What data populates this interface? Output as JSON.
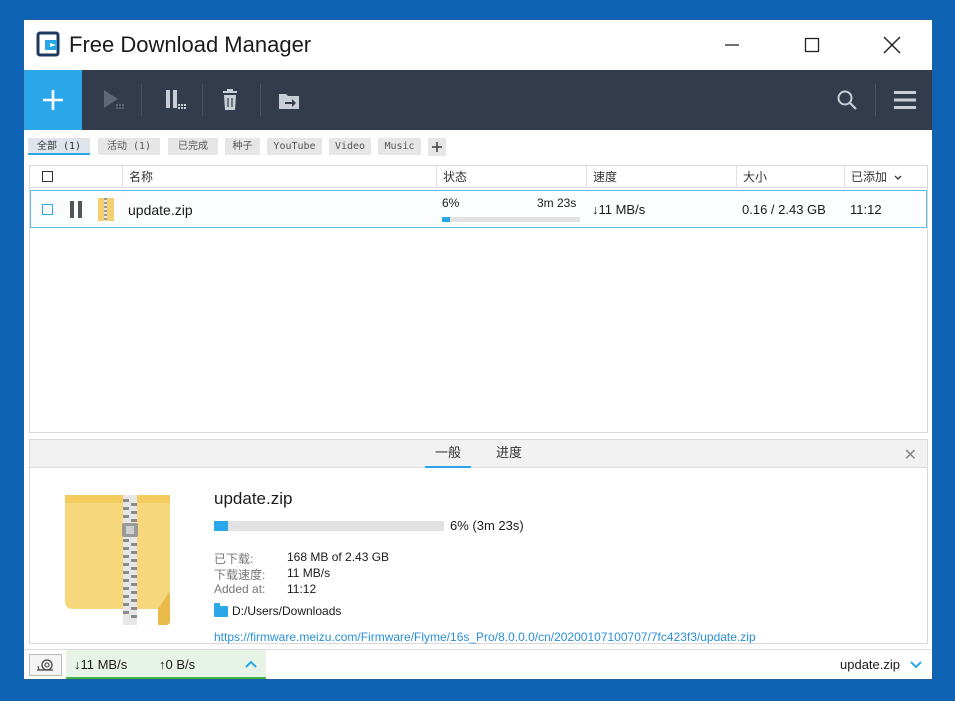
{
  "app": {
    "title": "Free Download Manager"
  },
  "colors": {
    "accent": "#2aa7e8",
    "toolbar": "#323c4c",
    "desktop": "#0e63b5",
    "status_green": "#3fb244"
  },
  "titlebar": {
    "icons": [
      "minimize-icon",
      "maximize-icon",
      "close-icon"
    ]
  },
  "toolbar": {
    "icons": [
      "add-icon",
      "resume-icon",
      "pause-icon",
      "delete-icon",
      "move-icon",
      "search-icon",
      "menu-icon"
    ]
  },
  "filters": {
    "tabs": [
      {
        "label": "全部 (1)",
        "active": true
      },
      {
        "label": "活动 (1)"
      },
      {
        "label": "已完成"
      },
      {
        "label": "种子"
      },
      {
        "label": "YouTube"
      },
      {
        "label": "Video"
      },
      {
        "label": "Music"
      }
    ],
    "add_icon": "plus-icon"
  },
  "list": {
    "columns": [
      "名称",
      "状态",
      "速度",
      "大小",
      "已添加"
    ],
    "sort_icon": "chevron-down-icon",
    "rows": [
      {
        "name": "update.zip",
        "percent": "6%",
        "remaining": "3m 23s",
        "progress": 0.06,
        "speed": "↓11 MB/s",
        "size": "0.16 / 2.43 GB",
        "added": "11:12"
      }
    ]
  },
  "details": {
    "tabs": [
      "一般",
      "进度"
    ],
    "active_tab": 0,
    "file_name": "update.zip",
    "progress": 0.06,
    "progress_text": "6% (3m 23s)",
    "fields": [
      {
        "label": "已下载:",
        "value": "168 MB of 2.43 GB"
      },
      {
        "label": "下载速度:",
        "value": "11 MB/s"
      },
      {
        "label": "Added at:",
        "value": "11:12"
      }
    ],
    "folder": "D:/Users/Downloads",
    "url": "https://firmware.meizu.com/Firmware/Flyme/16s_Pro/8.0.0.0/cn/20200107100707/7fc423f3/update.zip"
  },
  "statusbar": {
    "down": "↓11 MB/s",
    "up": "↑0 B/s",
    "current_file": "update.zip"
  }
}
